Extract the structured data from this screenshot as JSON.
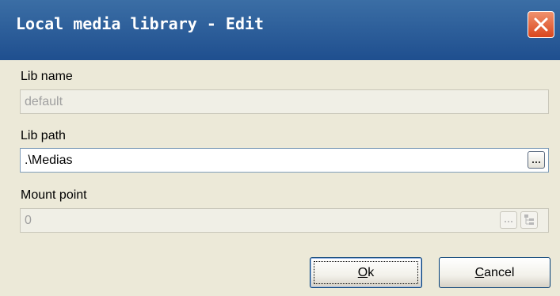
{
  "window": {
    "title": "Local media library - Edit",
    "close_icon": "close-icon"
  },
  "form": {
    "lib_name": {
      "label": "Lib name",
      "value": "default",
      "enabled": false
    },
    "lib_path": {
      "label": "Lib path",
      "value": ".\\Medias",
      "enabled": true,
      "browse_icon": "ellipsis-icon"
    },
    "mount_point": {
      "label": "Mount point",
      "value": "0",
      "enabled": false,
      "browse_icon": "ellipsis-icon",
      "tree_icon": "tree-icon"
    }
  },
  "buttons": {
    "ok": {
      "mnemonic": "O",
      "rest": "k"
    },
    "cancel": {
      "mnemonic": "C",
      "rest": "ancel"
    }
  },
  "colors": {
    "titlebar": "#1f4f8f",
    "close": "#d9461d",
    "dialog_bg": "#ece9d8"
  }
}
